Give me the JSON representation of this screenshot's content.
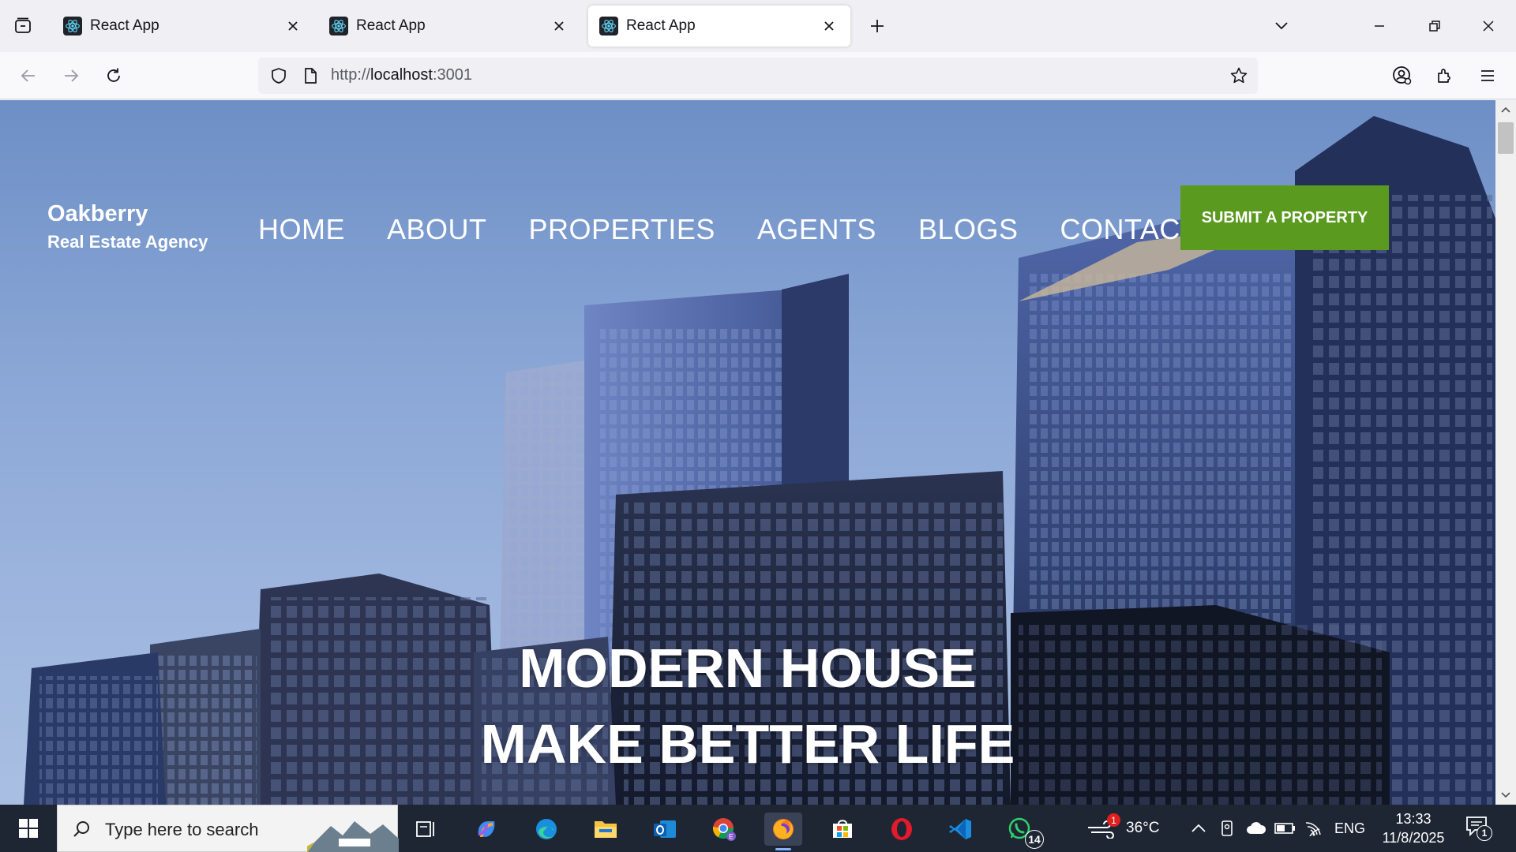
{
  "browser": {
    "tabs": [
      {
        "title": "React App",
        "active": false
      },
      {
        "title": "React App",
        "active": false
      },
      {
        "title": "React App",
        "active": true
      }
    ],
    "url_prefix": "http://",
    "url_host": "localhost",
    "url_suffix": ":3001"
  },
  "site": {
    "brand_name": "Oakberry",
    "brand_sub": "Real Estate Agency",
    "menu": [
      "HOME",
      "ABOUT",
      "PROPERTIES",
      "AGENTS",
      "BLOGS",
      "CONTACT"
    ],
    "cta_label": "SUBMIT A PROPERTY",
    "hero_line1": "MODERN HOUSE",
    "hero_line2": "MAKE BETTER LIFE",
    "accent_color": "#5a9a1f"
  },
  "taskbar": {
    "search_placeholder": "Type here to search",
    "apps": [
      "task-view",
      "copilot",
      "edge",
      "file-explorer",
      "outlook",
      "chrome",
      "firefox",
      "microsoft-store",
      "opera",
      "vs-code",
      "whatsapp"
    ],
    "whatsapp_badge": "14",
    "weather_badge": "1",
    "temperature": "36°C",
    "language": "ENG",
    "time": "13:33",
    "date": "11/8/2025",
    "notification_count": "1"
  }
}
